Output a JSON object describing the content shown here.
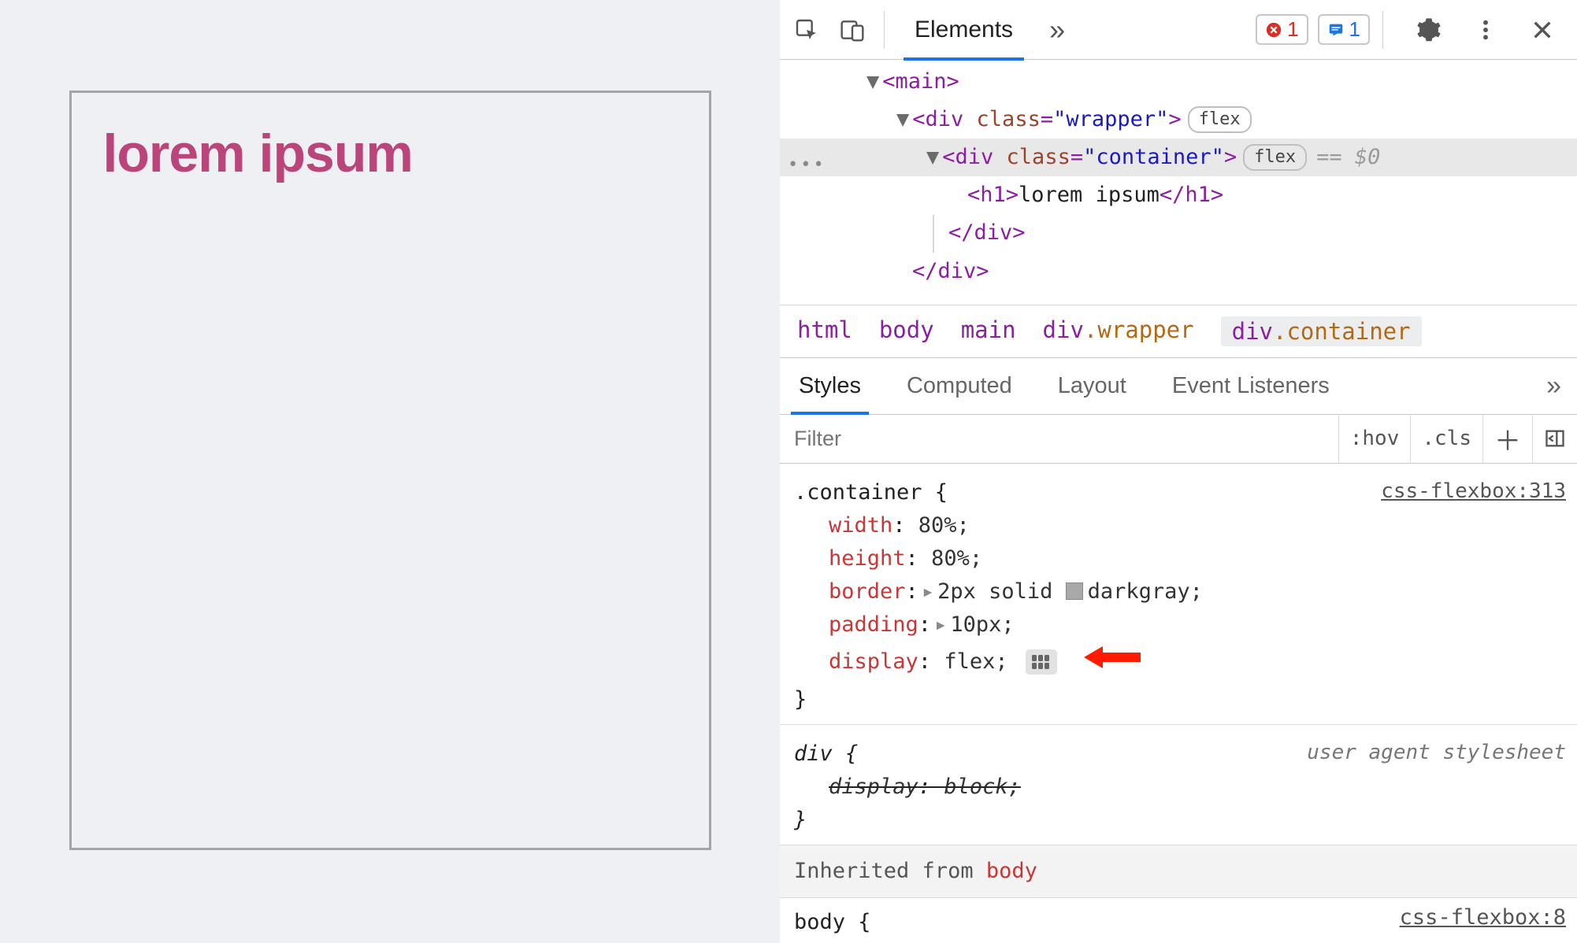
{
  "page": {
    "heading": "lorem ipsum"
  },
  "toolbar": {
    "tab_elements": "Elements",
    "overflow": "»",
    "error_count": "1",
    "message_count": "1"
  },
  "dom_tree": {
    "main_open": "<main>",
    "wrapper_open_prefix": "<div ",
    "wrapper_class_attr": "class",
    "wrapper_class_val": "\"wrapper\"",
    "wrapper_open_suffix": ">",
    "wrapper_pill": "flex",
    "container_open_prefix": "<div ",
    "container_class_attr": "class",
    "container_class_val": "\"container\"",
    "container_open_suffix": ">",
    "container_pill": "flex",
    "eq0": "== $0",
    "h1_open": "<h1>",
    "h1_text": "lorem ipsum",
    "h1_close": "</h1>",
    "div_close1": "</div>",
    "div_close2": "</div>"
  },
  "breadcrumbs": {
    "b1": "html",
    "b2": "body",
    "b3": "main",
    "b4a": "div",
    "b4b": ".wrapper",
    "b5a": "div",
    "b5b": ".container"
  },
  "subtabs": {
    "styles": "Styles",
    "computed": "Computed",
    "layout": "Layout",
    "listeners": "Event Listeners",
    "overflow": "»"
  },
  "filter": {
    "placeholder": "Filter",
    "hov": ":hov",
    "cls": ".cls"
  },
  "rules": {
    "r1": {
      "selector": ".container {",
      "source": "css-flexbox:313",
      "props": {
        "p1": {
          "name": "width",
          "value": "80%;"
        },
        "p2": {
          "name": "height",
          "value": "80%;"
        },
        "p3": {
          "name": "border",
          "value_pre": "2px solid ",
          "value_color": "darkgray;"
        },
        "p4": {
          "name": "padding",
          "value": "10px;"
        },
        "p5": {
          "name": "display",
          "value": "flex;"
        }
      },
      "close": "}"
    },
    "r2": {
      "selector": "div {",
      "source": "user agent stylesheet",
      "props": {
        "p1": {
          "name": "display",
          "value": "block;"
        }
      },
      "close": "}"
    },
    "inherit_label": "Inherited from ",
    "inherit_from": "body",
    "r3": {
      "selector": "body {",
      "source": "css-flexbox:8"
    }
  }
}
